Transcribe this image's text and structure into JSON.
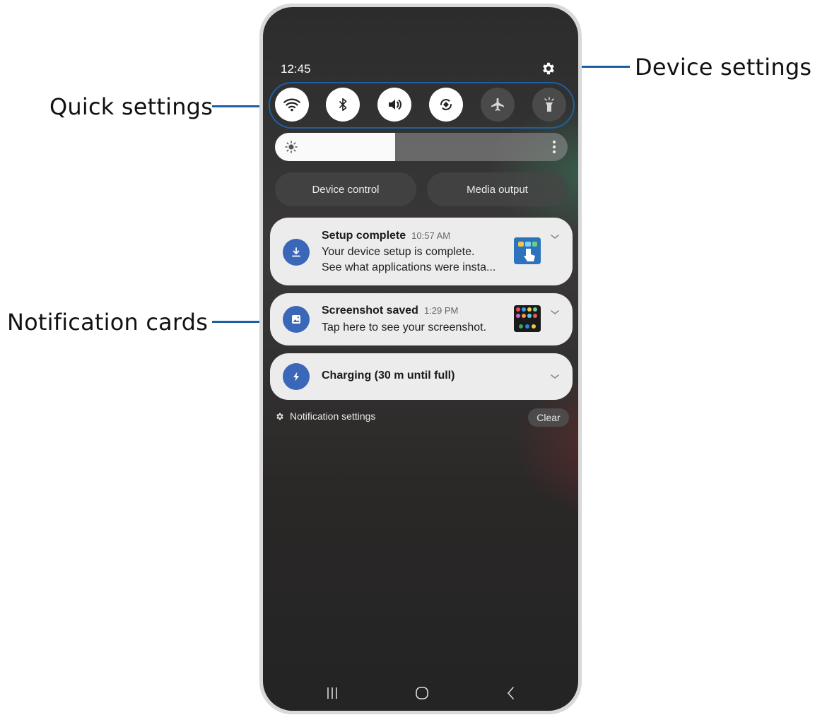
{
  "callouts": {
    "device_settings": "Device settings",
    "quick_settings": "Quick settings",
    "notification_cards": "Notification cards"
  },
  "status_bar": {
    "time": "12:45"
  },
  "quick_settings": [
    {
      "name": "Wi-Fi",
      "icon": "wifi-icon",
      "state": "on"
    },
    {
      "name": "Bluetooth",
      "icon": "bluetooth-icon",
      "state": "on"
    },
    {
      "name": "Sound",
      "icon": "volume-icon",
      "state": "on"
    },
    {
      "name": "Auto rotate",
      "icon": "rotate-icon",
      "state": "on"
    },
    {
      "name": "Airplane mode",
      "icon": "airplane-icon",
      "state": "off"
    },
    {
      "name": "Flashlight",
      "icon": "flashlight-icon",
      "state": "off"
    }
  ],
  "brightness": {
    "level": 0.41
  },
  "buttons": {
    "device_control": "Device control",
    "media_output": "Media output"
  },
  "notifications": [
    {
      "title": "Setup complete",
      "time": "10:57 AM",
      "line1": "Your device setup is complete.",
      "line2": "See what applications were insta...",
      "icon": "download-icon"
    },
    {
      "title": "Screenshot saved",
      "time": "1:29 PM",
      "line1": "Tap here to see your screenshot.",
      "icon": "image-icon"
    },
    {
      "title": "Charging (30 m until full)",
      "icon": "lightning-icon"
    }
  ],
  "footer": {
    "notification_settings": "Notification settings",
    "clear": "Clear"
  },
  "colors": {
    "accent": "#1d5fa3",
    "notification_icon_bg": "#3a67b7",
    "card_bg": "#ececec"
  }
}
